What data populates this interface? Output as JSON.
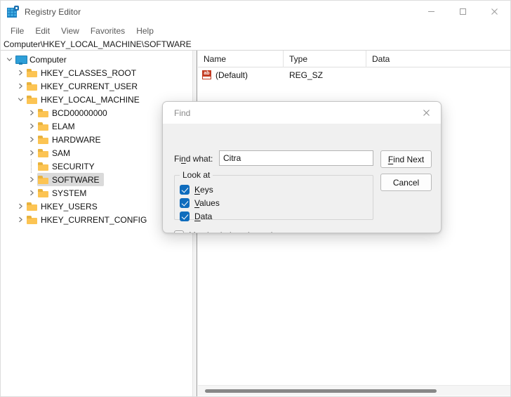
{
  "window": {
    "title": "Registry Editor",
    "icon": "registry-editor-icon",
    "controls": {
      "minimize": "minimize-icon",
      "maximize": "maximize-icon",
      "close": "close-icon"
    }
  },
  "menu": {
    "items": [
      {
        "label": "File"
      },
      {
        "label": "Edit"
      },
      {
        "label": "View"
      },
      {
        "label": "Favorites"
      },
      {
        "label": "Help"
      }
    ]
  },
  "address": {
    "path": "Computer\\HKEY_LOCAL_MACHINE\\SOFTWARE"
  },
  "tree": {
    "items": [
      {
        "label": "Computer",
        "indent": 0,
        "icon": "monitor-icon",
        "expander": "expanded",
        "selected": false
      },
      {
        "label": "HKEY_CLASSES_ROOT",
        "indent": 1,
        "icon": "folder-icon",
        "expander": "collapsed",
        "selected": false
      },
      {
        "label": "HKEY_CURRENT_USER",
        "indent": 1,
        "icon": "folder-icon",
        "expander": "collapsed",
        "selected": false
      },
      {
        "label": "HKEY_LOCAL_MACHINE",
        "indent": 1,
        "icon": "folder-icon",
        "expander": "expanded",
        "selected": false
      },
      {
        "label": "BCD00000000",
        "indent": 2,
        "icon": "folder-icon",
        "expander": "collapsed",
        "selected": false
      },
      {
        "label": "ELAM",
        "indent": 2,
        "icon": "folder-icon",
        "expander": "collapsed",
        "selected": false
      },
      {
        "label": "HARDWARE",
        "indent": 2,
        "icon": "folder-icon",
        "expander": "collapsed",
        "selected": false
      },
      {
        "label": "SAM",
        "indent": 2,
        "icon": "folder-icon",
        "expander": "collapsed",
        "selected": false
      },
      {
        "label": "SECURITY",
        "indent": 2,
        "icon": "folder-icon",
        "expander": "none",
        "selected": false
      },
      {
        "label": "SOFTWARE",
        "indent": 2,
        "icon": "folder-icon",
        "expander": "collapsed",
        "selected": true
      },
      {
        "label": "SYSTEM",
        "indent": 2,
        "icon": "folder-icon",
        "expander": "collapsed",
        "selected": false
      },
      {
        "label": "HKEY_USERS",
        "indent": 1,
        "icon": "folder-icon",
        "expander": "collapsed",
        "selected": false
      },
      {
        "label": "HKEY_CURRENT_CONFIG",
        "indent": 1,
        "icon": "folder-icon",
        "expander": "collapsed",
        "selected": false
      }
    ]
  },
  "list": {
    "columns": [
      "Name",
      "Type",
      "Data"
    ],
    "rows": [
      {
        "icon": "string-value-icon",
        "name": "(Default)",
        "type": "REG_SZ",
        "data": ""
      }
    ]
  },
  "dialog": {
    "title": "Find",
    "close_icon": "close-icon",
    "find_what": {
      "label_pre": "Fi",
      "label_accel": "n",
      "label_post": "d what:",
      "value": "Citra",
      "placeholder": ""
    },
    "buttons": {
      "find_next": {
        "pre": "",
        "accel": "F",
        "post": "ind Next"
      },
      "cancel": {
        "pre": "",
        "accel": "",
        "post": "Cancel"
      }
    },
    "look_at": {
      "legend": "Look at",
      "options": [
        {
          "pre": "",
          "accel": "K",
          "post": "eys",
          "checked": true
        },
        {
          "pre": "",
          "accel": "V",
          "post": "alues",
          "checked": true
        },
        {
          "pre": "",
          "accel": "D",
          "post": "ata",
          "checked": true
        }
      ]
    },
    "match_whole": {
      "pre": "Match ",
      "accel": "w",
      "post": "hole string only",
      "checked": false
    }
  },
  "colors": {
    "accent": "#0f6cbd",
    "folder": "#fcc453",
    "selection": "#dadada",
    "dialog_bg": "#f0f0f0"
  }
}
